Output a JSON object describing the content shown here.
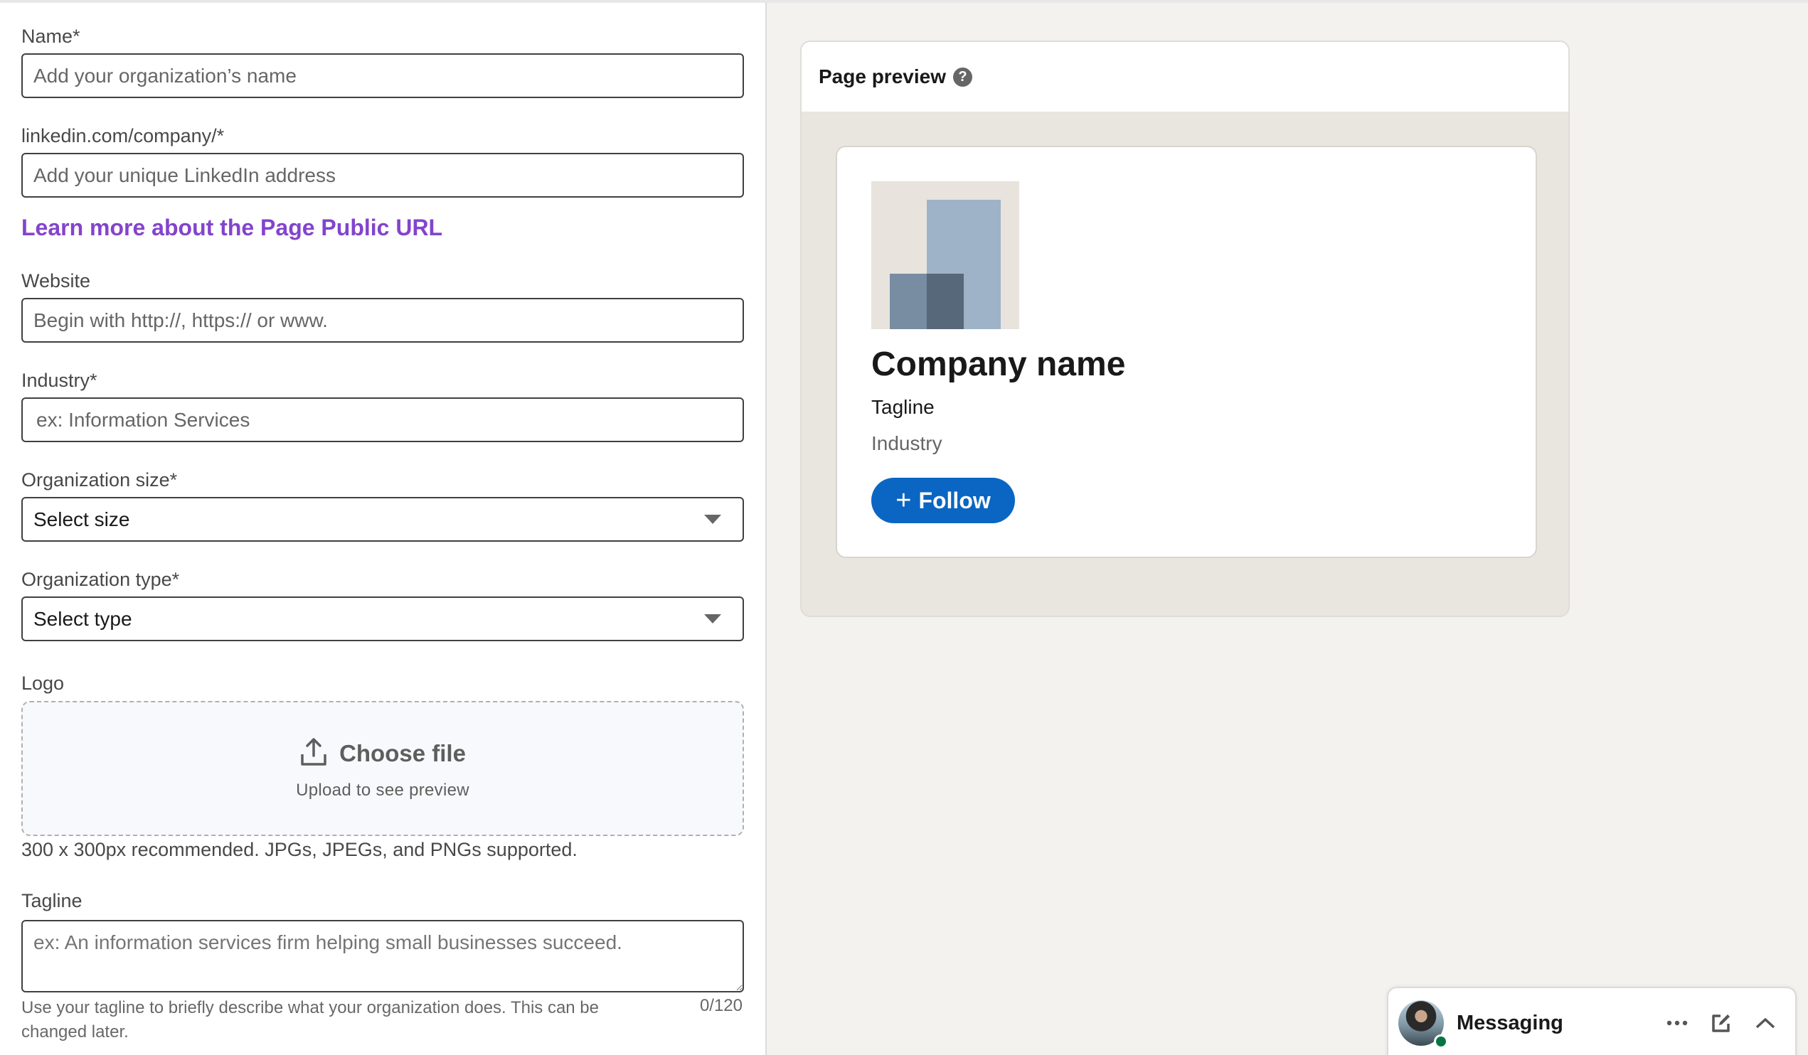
{
  "form": {
    "name": {
      "label": "Name*",
      "placeholder": "Add your organization’s name"
    },
    "url": {
      "label": "linkedin.com/company/*",
      "placeholder": "Add your unique LinkedIn address"
    },
    "learn_more_link": "Learn more about the Page Public URL",
    "website": {
      "label": "Website",
      "placeholder": "Begin with http://, https:// or www."
    },
    "industry": {
      "label": "Industry*",
      "placeholder": "ex: Information Services"
    },
    "org_size": {
      "label": "Organization size*",
      "selected": "Select size"
    },
    "org_type": {
      "label": "Organization type*",
      "selected": "Select type"
    },
    "logo": {
      "label": "Logo",
      "choose_file": "Choose file",
      "upload_hint": "Upload to see preview",
      "helper": "300 x 300px recommended. JPGs, JPEGs, and PNGs supported."
    },
    "tagline": {
      "label": "Tagline",
      "placeholder": "ex: An information services firm helping small businesses succeed.",
      "helper": "Use your tagline to briefly describe what your organization does. This can be changed later.",
      "counter": "0/120"
    }
  },
  "preview": {
    "title": "Page preview",
    "help_icon": "?",
    "company_name": "Company name",
    "tagline": "Tagline",
    "industry": "Industry",
    "follow_label": "Follow",
    "follow_icon": "+",
    "colors": {
      "follow_bg": "#0a66c2",
      "link": "#8344cc"
    }
  },
  "messaging": {
    "label": "Messaging",
    "presence_color": "#057642"
  }
}
